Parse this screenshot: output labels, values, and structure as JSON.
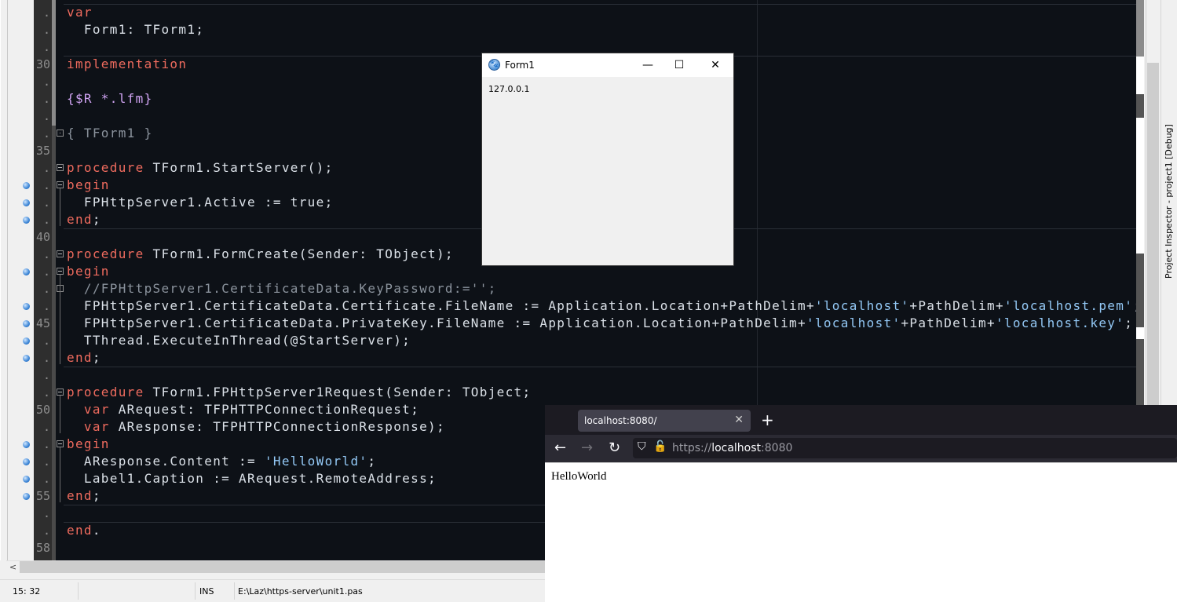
{
  "editor": {
    "first_line": 27,
    "breakpoint_lines": [
      37,
      38,
      39,
      42,
      44,
      45,
      46,
      47,
      52,
      53,
      54,
      55
    ],
    "fold_lines": {
      "34": "dot",
      "36": "minus",
      "37": "minus",
      "41": "minus",
      "42": "minus",
      "43": "dot",
      "49": "minus",
      "52": "minus"
    },
    "token_colors": {
      "kw": "#ef6b5e",
      "id": "#dbe1e8",
      "str": "#93c8f5",
      "cm": "#8b939d",
      "dir": "#cfa3f2"
    },
    "lines": [
      [
        [
          "kw",
          "var"
        ]
      ],
      [
        [
          "id",
          "  Form1: TForm1;"
        ]
      ],
      [],
      [
        [
          "kw",
          "implementation"
        ]
      ],
      [],
      [
        [
          "dir",
          "{$R *.lfm}"
        ]
      ],
      [],
      [
        [
          "cm",
          "{ TForm1 }"
        ]
      ],
      [],
      [
        [
          "kw",
          "procedure"
        ],
        [
          "id",
          " TForm1.StartServer();"
        ]
      ],
      [
        [
          "kw",
          "begin"
        ]
      ],
      [
        [
          "id",
          "  FPHttpServer1.Active := true;"
        ]
      ],
      [
        [
          "kw",
          "end"
        ],
        [
          "id",
          ";"
        ]
      ],
      [],
      [
        [
          "kw",
          "procedure"
        ],
        [
          "id",
          " TForm1.FormCreate(Sender: TObject);"
        ]
      ],
      [
        [
          "kw",
          "begin"
        ]
      ],
      [
        [
          "cm",
          "  //FPHttpServer1.CertificateData.KeyPassword:='';"
        ]
      ],
      [
        [
          "id",
          "  FPHttpServer1.CertificateData.Certificate.FileName := Application.Location+PathDelim+"
        ],
        [
          "str",
          "'localhost'"
        ],
        [
          "id",
          "+PathDelim+"
        ],
        [
          "str",
          "'localhost.pem'"
        ],
        [
          "id",
          ";"
        ]
      ],
      [
        [
          "id",
          "  FPHttpServer1.CertificateData.PrivateKey.FileName := Application.Location+PathDelim+"
        ],
        [
          "str",
          "'localhost'"
        ],
        [
          "id",
          "+PathDelim+"
        ],
        [
          "str",
          "'localhost.key'"
        ],
        [
          "id",
          ";"
        ]
      ],
      [
        [
          "id",
          "  TThread.ExecuteInThread(@StartServer);"
        ]
      ],
      [
        [
          "kw",
          "end"
        ],
        [
          "id",
          ";"
        ]
      ],
      [],
      [
        [
          "kw",
          "procedure"
        ],
        [
          "id",
          " TForm1.FPHttpServer1Request(Sender: TObject;"
        ]
      ],
      [
        [
          "id",
          "  "
        ],
        [
          "kw",
          "var"
        ],
        [
          "id",
          " ARequest: TFPHTTPConnectionRequest;"
        ]
      ],
      [
        [
          "id",
          "  "
        ],
        [
          "kw",
          "var"
        ],
        [
          "id",
          " AResponse: TFPHTTPConnectionResponse);"
        ]
      ],
      [
        [
          "kw",
          "begin"
        ]
      ],
      [
        [
          "id",
          "  AResponse.Content := "
        ],
        [
          "str",
          "'HelloWorld'"
        ],
        [
          "id",
          ";"
        ]
      ],
      [
        [
          "id",
          "  Label1.Caption := ARequest.RemoteAddress;"
        ]
      ],
      [
        [
          "kw",
          "end"
        ],
        [
          "id",
          ";"
        ]
      ],
      [],
      [
        [
          "kw",
          "end"
        ],
        [
          "id",
          "."
        ]
      ],
      []
    ]
  },
  "side_panel": {
    "title": "Project Inspector - project1 [Debug]"
  },
  "statusbar": {
    "position": "15: 32",
    "mode": "INS",
    "file": "E:\\Laz\\https-server\\unit1.pas"
  },
  "form1": {
    "title": "Form1",
    "label": "127.0.0.1",
    "minimize": "—",
    "maximize": "☐",
    "close": "✕"
  },
  "browser": {
    "tab_title": "localhost:8080/",
    "tab_close": "✕",
    "new_tab": "+",
    "back": "←",
    "forward": "→",
    "reload": "↻",
    "url_scheme": "https://",
    "url_host": "localhost",
    "url_port": ":8080",
    "content": "HelloWorld"
  }
}
